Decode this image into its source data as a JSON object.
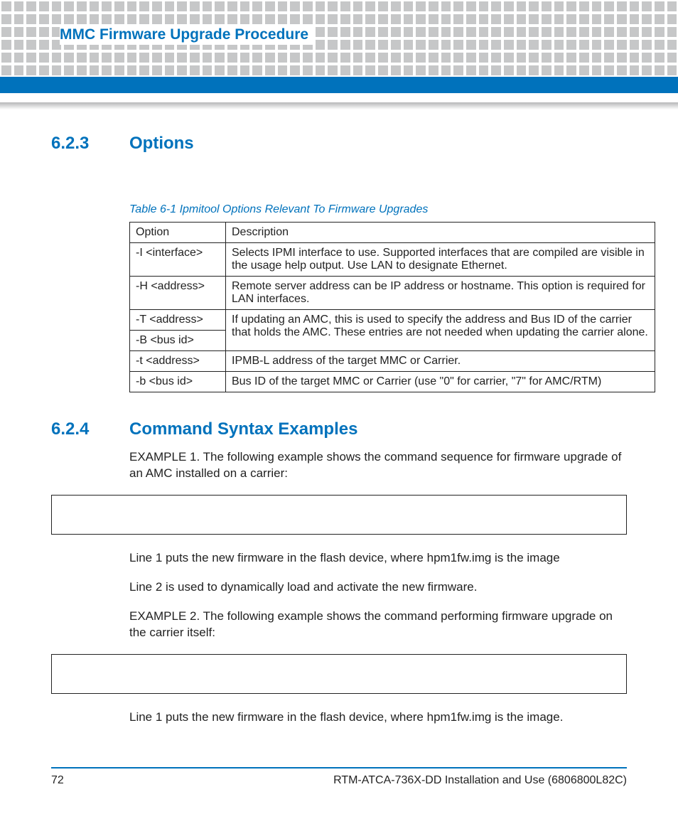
{
  "header": {
    "title": "MMC Firmware Upgrade Procedure"
  },
  "sections": {
    "options": {
      "number": "6.2.3",
      "title": "Options",
      "table_caption": "Table 6-1 Ipmitool Options Relevant To Firmware Upgrades",
      "table": {
        "headers": [
          "Option",
          "Description"
        ],
        "rows": [
          {
            "option": "-I <interface>",
            "description": "Selects IPMI interface to use. Supported interfaces that are compiled are visible in the usage help output.  Use LAN to designate Ethernet."
          },
          {
            "option": "-H <address>",
            "description": "Remote server address can be IP address or hostname. This option is required for LAN interfaces."
          },
          {
            "option": "-T <address>",
            "description_merged": "If updating an AMC, this is used to specify the address and Bus ID of the carrier that holds the AMC.  These entries are not needed when updating the carrier alone."
          },
          {
            "option": "-B <bus id>"
          },
          {
            "option": "-t <address>",
            "description": "IPMB-L address of the target MMC or Carrier."
          },
          {
            "option": "-b <bus id>",
            "description": "Bus ID of the target MMC or Carrier (use \"0\" for carrier, \"7\" for  AMC/RTM)"
          }
        ]
      }
    },
    "examples": {
      "number": "6.2.4",
      "title": "Command Syntax Examples",
      "intro1": "EXAMPLE 1. The following example shows the command sequence for firmware upgrade of an AMC installed on a carrier:",
      "line1a": "Line 1 puts the new firmware in the flash device, where hpm1fw.img is the image",
      "line2a": "Line 2 is used to dynamically load and activate the new firmware.",
      "intro2": "EXAMPLE 2. The following example shows the command performing firmware upgrade on the carrier itself:",
      "line1b": "Line 1 puts the new firmware in the flash device, where hpm1fw.img is the image."
    }
  },
  "footer": {
    "page": "72",
    "doc": "RTM-ATCA-736X-DD Installation and Use (6806800L82C)"
  }
}
